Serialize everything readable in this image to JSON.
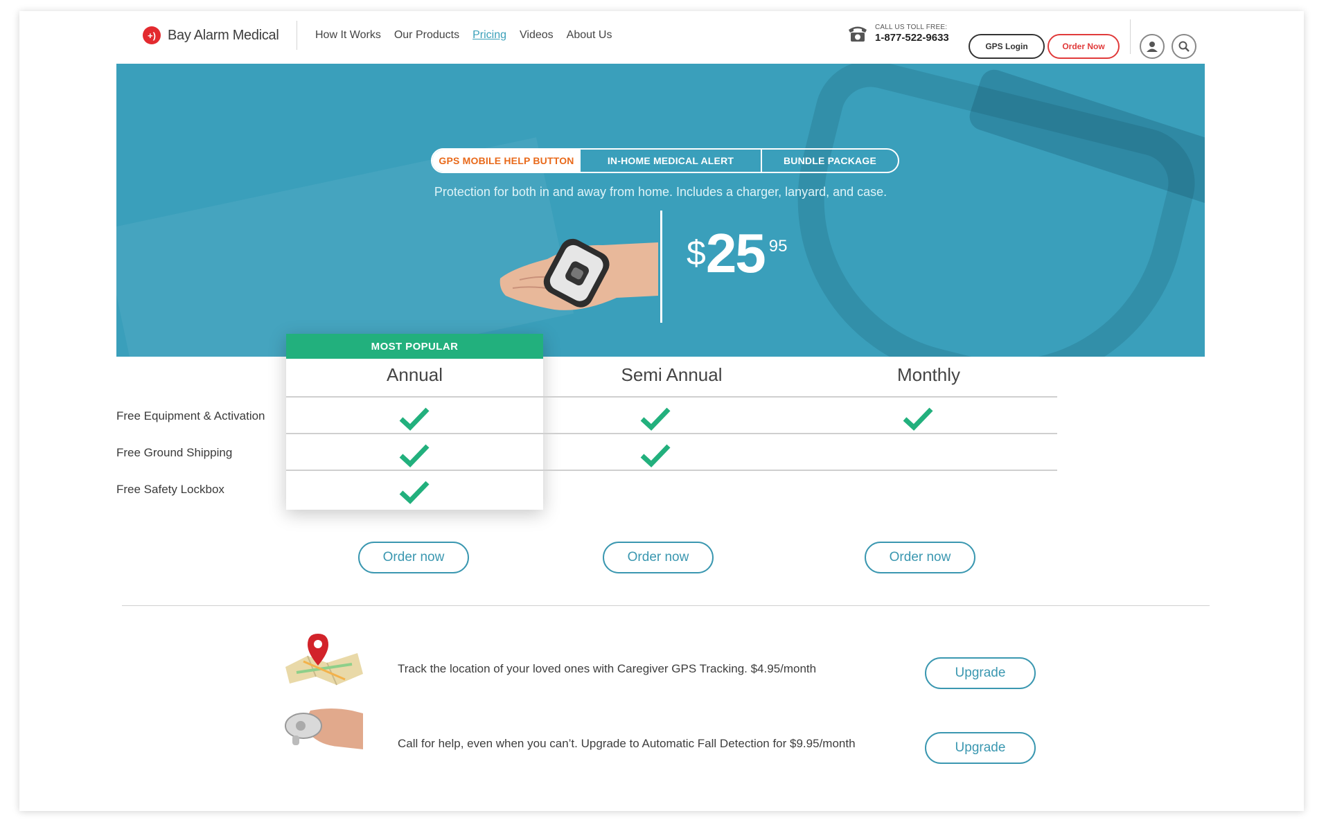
{
  "header": {
    "brand": "Bay Alarm Medical",
    "nav": [
      "How It Works",
      "Our Products",
      "Pricing",
      "Videos",
      "About Us"
    ],
    "active_nav": "Pricing",
    "call_label": "CALL US TOLL FREE:",
    "phone": "1-877-522-9633",
    "gps_login": "GPS Login",
    "order_now": "Order Now"
  },
  "hero": {
    "tabs": [
      "GPS MOBILE HELP BUTTON",
      "IN-HOME MEDICAL ALERT",
      "BUNDLE PACKAGE"
    ],
    "active_tab": "GPS MOBILE HELP BUTTON",
    "subtitle": "Protection for both in and away from home. Includes a charger, lanyard, and case.",
    "price_currency": "$",
    "price_whole": "25",
    "price_cents": "95"
  },
  "plans": {
    "popular_tag": "MOST POPULAR",
    "columns": [
      "Annual",
      "Semi Annual",
      "Monthly"
    ],
    "features": [
      {
        "label": "Free Equipment & Activation",
        "included": [
          true,
          true,
          true
        ]
      },
      {
        "label": "Free Ground Shipping",
        "included": [
          true,
          true,
          false
        ]
      },
      {
        "label": "Free Safety Lockbox",
        "included": [
          true,
          false,
          false
        ]
      }
    ],
    "order_label": "Order now"
  },
  "addons": [
    {
      "text": "Track the location of your loved ones with Caregiver GPS Tracking. $4.95/month",
      "button": "Upgrade",
      "icon": "map-pin-icon"
    },
    {
      "text": "Call for help, even when you can’t. Upgrade to Automatic Fall Detection for $9.95/month",
      "button": "Upgrade",
      "icon": "fall-detection-device-icon"
    }
  ],
  "colors": {
    "hero_bg": "#3a9fbb",
    "accent_teal": "#3a97b0",
    "popular_green": "#22b07d",
    "check_green": "#22b07d",
    "brand_red": "#e32a2f",
    "active_tab_text": "#e8691a"
  }
}
